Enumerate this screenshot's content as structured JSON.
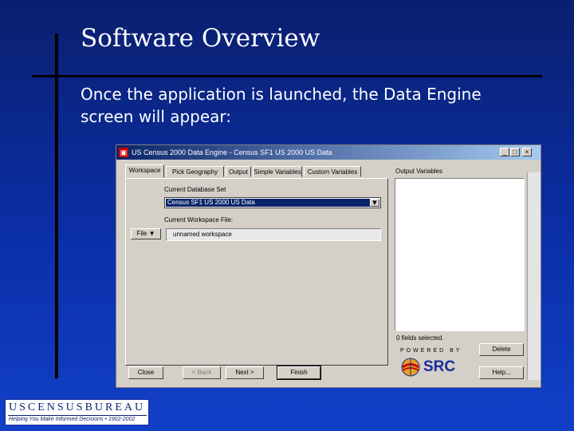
{
  "slide": {
    "title": "Software Overview",
    "body_line1": "Once the application is launched, the Data Engine",
    "body_line2": "screen will appear:"
  },
  "window": {
    "title": "US Census 2000 Data Engine - Census SF1 US 2000 US Data",
    "minimize": "_",
    "maximize": "□",
    "close": "×",
    "tabs": [
      "Workspace",
      "Pick Geography",
      "Output",
      "Simple Variables",
      "Custom Variables"
    ],
    "active_tab": "Workspace",
    "current_database_label": "Current Database Set",
    "current_database_value": "Census SF1 US 2000 US Data",
    "current_workspace_label": "Current Workspace File:",
    "file_button": "File ▼",
    "workspace_value": "unnamed workspace",
    "output_variables_label": "Output Variables",
    "fields_selected": "0 fields selected.",
    "powered_by": "POWERED BY",
    "src": "SRC",
    "buttons": {
      "close": "Close",
      "back": "< Back",
      "next": "Next >",
      "finish": "Finish",
      "delete": "Delete",
      "help": "Help..."
    }
  },
  "logo": {
    "name": "USCENSUSBUREAU",
    "tagline": "Helping You Make Informed Decisions • 1902-2002"
  },
  "colors": {
    "background_top": "#0a1f6e",
    "background_bottom": "#1140c8",
    "window_face": "#d4d0c8",
    "titlebar": "#0a246a"
  }
}
